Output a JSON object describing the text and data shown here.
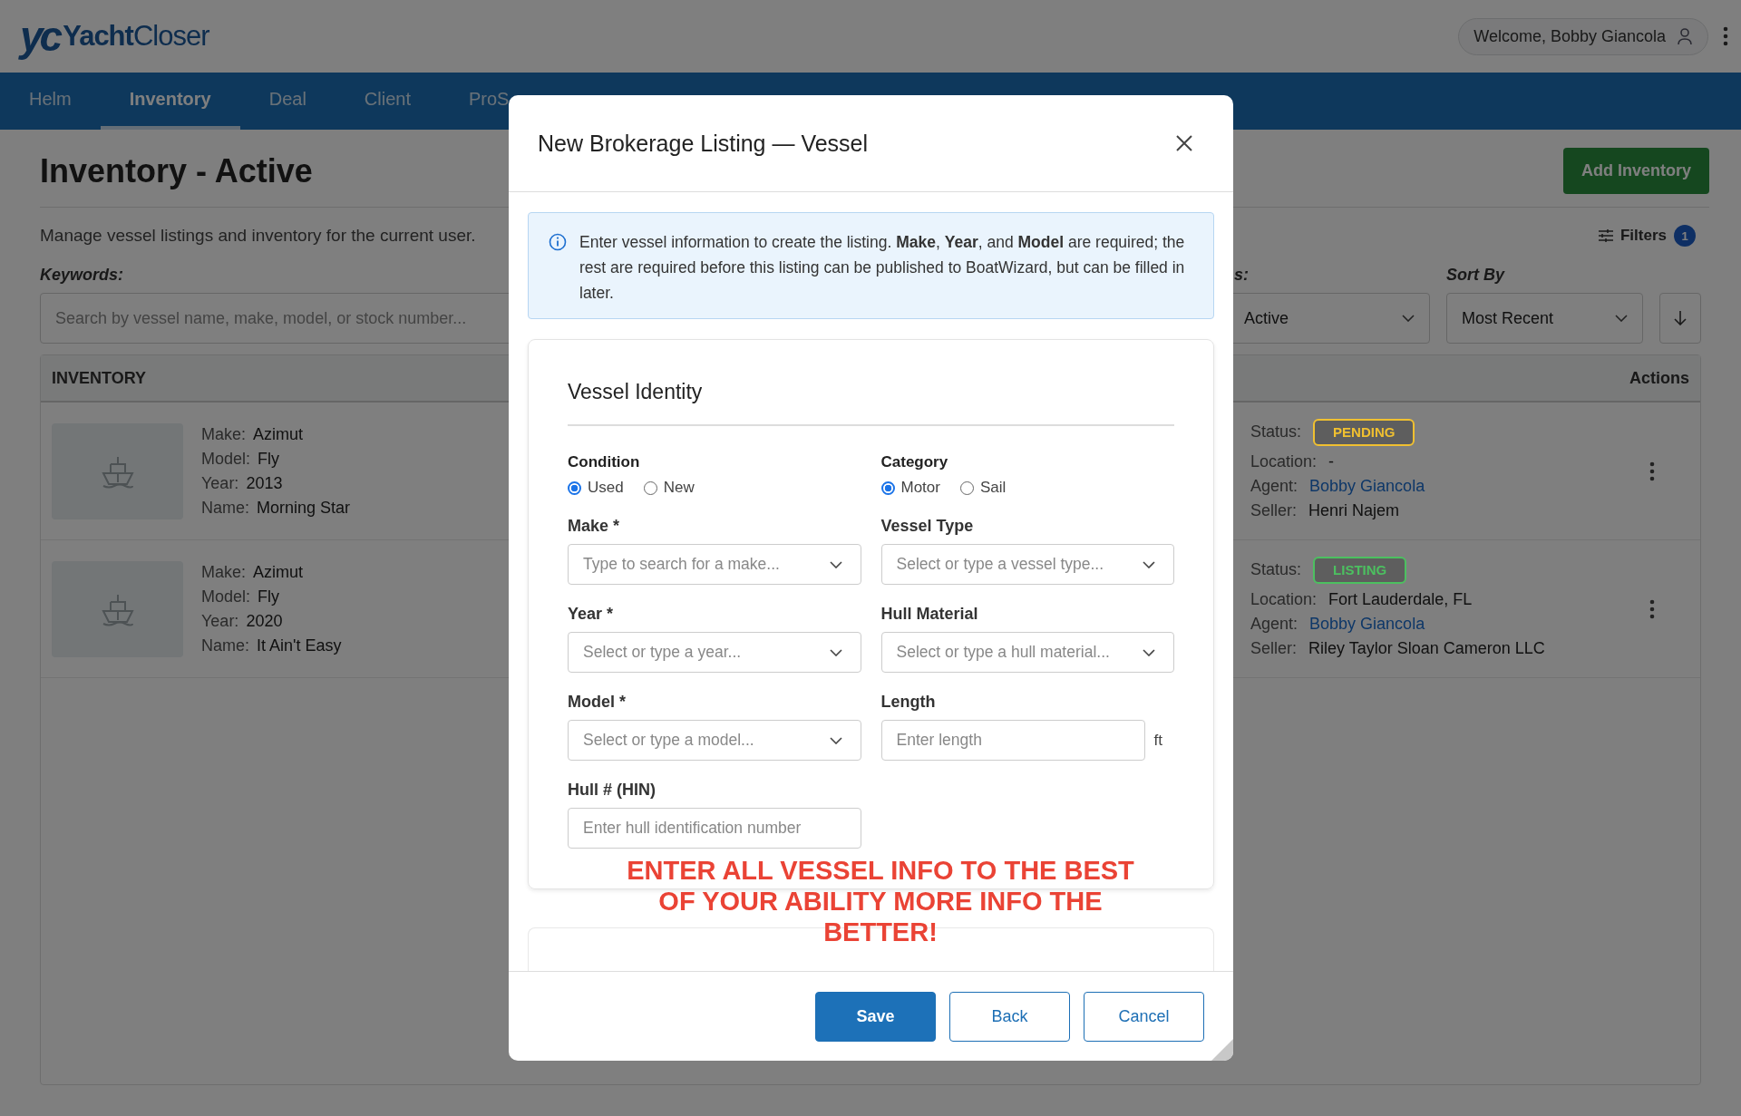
{
  "header": {
    "logo_mark": "yc",
    "logo_name": "**Yacht**Closer",
    "welcome": "Welcome, Bobby Giancola"
  },
  "nav": [
    {
      "label": "Helm",
      "selected": false
    },
    {
      "label": "Inventory",
      "selected": true
    },
    {
      "label": "Deal",
      "selected": false
    },
    {
      "label": "Client",
      "selected": false
    },
    {
      "label": "ProS",
      "selected": false
    }
  ],
  "page": {
    "title": "Inventory - Active",
    "add_button": "Add Inventory",
    "description": "Manage vessel listings and inventory for the current user.",
    "filters": {
      "label": "Filters",
      "count": "1"
    },
    "keywords_label": "Keywords:",
    "search_placeholder": "Search by vessel name, make, model, or stock number...",
    "status_label": "s:",
    "status_value": "Active",
    "sort_label": "Sort By",
    "sort_value": "Most Recent"
  },
  "table": {
    "columns": [
      "INVENTORY",
      "Actions"
    ],
    "rows": [
      {
        "details": [
          {
            "label": "Make:",
            "value": "Azimut"
          },
          {
            "label": "Model:",
            "value": "Fly"
          },
          {
            "label": "Year:",
            "value": "2013"
          },
          {
            "label": "Name:",
            "value": "Morning Star"
          }
        ],
        "status_label": "Status:",
        "status": {
          "text": "PENDING",
          "color": "#f0c030"
        },
        "info": [
          {
            "label": "Location:",
            "value": "-",
            "kind": "text"
          },
          {
            "label": "Agent:",
            "value": "Bobby Giancola",
            "kind": "link"
          },
          {
            "label": "Seller:",
            "value": "Henri Najem",
            "kind": "text"
          }
        ]
      },
      {
        "details": [
          {
            "label": "Make:",
            "value": "Azimut"
          },
          {
            "label": "Model:",
            "value": "Fly"
          },
          {
            "label": "Year:",
            "value": "2020"
          },
          {
            "label": "Name:",
            "value": "It Ain't Easy"
          }
        ],
        "status_label": "Status:",
        "status": {
          "text": "LISTING",
          "color": "#4cc060"
        },
        "info": [
          {
            "label": "Location:",
            "value": "Fort Lauderdale, FL",
            "kind": "text"
          },
          {
            "label": "Agent:",
            "value": "Bobby Giancola",
            "kind": "link"
          },
          {
            "label": "Seller:",
            "value": "Riley Taylor Sloan Cameron LLC",
            "kind": "text"
          }
        ]
      }
    ]
  },
  "modal": {
    "title": "New Brokerage Listing — Vessel",
    "info": "Enter vessel information to create the listing. **Make**, **Year**, and **Model** are required; the rest are required before this listing can be published to BoatWizard, but can be filled in later.",
    "section_title": "Vessel Identity",
    "radio_groups": [
      {
        "label": "Condition",
        "options": [
          {
            "label": "Used",
            "selected": true
          },
          {
            "label": "New",
            "selected": false
          }
        ]
      },
      {
        "label": "Category",
        "options": [
          {
            "label": "Motor",
            "selected": true
          },
          {
            "label": "Sail",
            "selected": false
          }
        ]
      }
    ],
    "fields": [
      {
        "label": "Make",
        "required_mark": "*",
        "kind": "select",
        "placeholder": "Type to search for a make..."
      },
      {
        "label": "Vessel Type",
        "kind": "select",
        "placeholder": "Select or type a vessel type..."
      },
      {
        "label": "Year",
        "required_mark": "*",
        "kind": "select",
        "placeholder": "Select or type a year..."
      },
      {
        "label": "Hull Material",
        "kind": "select",
        "placeholder": "Select or type a hull material..."
      },
      {
        "label": "Model",
        "required_mark": "*",
        "kind": "select",
        "placeholder": "Select or type a model..."
      },
      {
        "label": "Length",
        "kind": "input",
        "placeholder": "Enter length",
        "unit": "ft"
      },
      {
        "label": "Hull # (HIN)",
        "kind": "input",
        "placeholder": "Enter hull identification number"
      }
    ],
    "annotation": "ENTER ALL VESSEL INFO TO THE BEST OF YOUR ABILITY MORE INFO THE BETTER!",
    "buttons": [
      {
        "label": "Save",
        "kind": "primary"
      },
      {
        "label": "Back",
        "kind": "secondary"
      },
      {
        "label": "Cancel",
        "kind": "secondary"
      }
    ]
  }
}
